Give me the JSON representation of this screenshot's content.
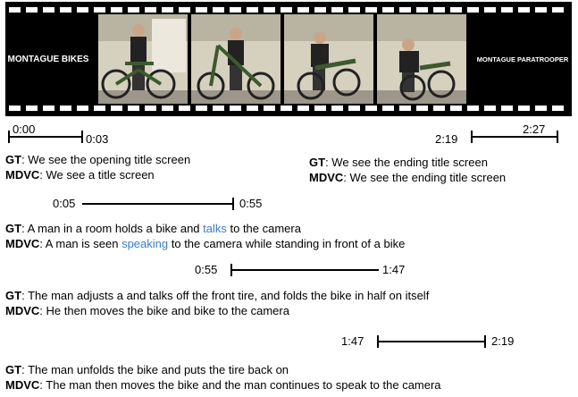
{
  "filmstrip": {
    "title_left": "MONTAGUE BIKES",
    "title_right": "MONTAGUE PARATROOPER",
    "frame_count": 4
  },
  "timeline_labels": {
    "seg1_start": "0:00",
    "seg1_end": "0:03",
    "seg2_start": "2:19",
    "seg2_end": "2:27",
    "seg3_start": "0:05",
    "seg3_end": "0:55",
    "seg4_start": "0:55",
    "seg4_end": "1:47",
    "seg5_start": "1:47",
    "seg5_end": "2:19"
  },
  "captions": {
    "gt_tag": "GT",
    "mdvc_tag": "MDVC",
    "sep": ": ",
    "c1_gt": "We see the opening title screen",
    "c1_mdvc": "We see a title screen",
    "c2_gt": "We see the ending title screen",
    "c2_mdvc": "We see the ending title screen",
    "c3_gt_a": "A man in a room holds a bike and ",
    "c3_gt_hl": "talks",
    "c3_gt_b": " to the camera",
    "c3_mdvc_a": "A man is seen ",
    "c3_mdvc_hl": "speaking",
    "c3_mdvc_b": " to the camera while standing in front of a bike",
    "c4_gt": "The man adjusts a and talks off the front tire, and folds the bike in half on itself",
    "c4_mdvc": "He then moves the bike and bike to the camera",
    "c5_gt": "The man unfolds the bike and puts the tire back on",
    "c5_mdvc": "The man then moves the bike and the man continues to speak to the camera"
  },
  "colors": {
    "highlight": "#3b7dc4",
    "film": "#000000"
  }
}
